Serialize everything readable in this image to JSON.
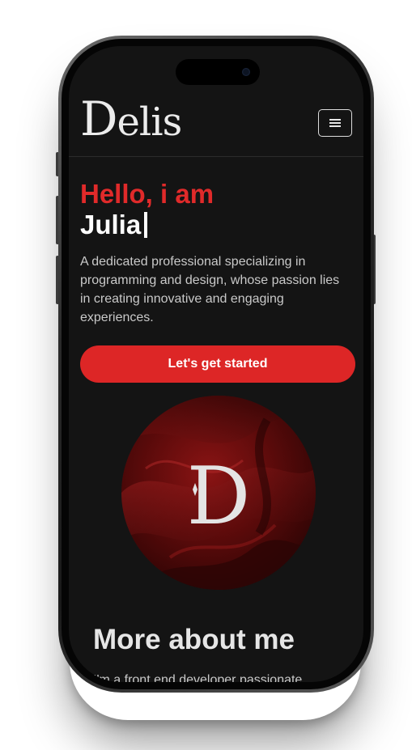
{
  "brand": {
    "logo_text": "Delis",
    "avatar_monogram": "D"
  },
  "header": {
    "menu_label": "Open menu"
  },
  "hero": {
    "greeting": "Hello, i am",
    "name": "Julia",
    "description": "A dedicated professional specializing in programming and design, whose passion lies in creating innovative and engaging experiences.",
    "cta_label": "Let's get started"
  },
  "about": {
    "title": "More about me",
    "intro": "I'm a front end developer passionate"
  },
  "colors": {
    "accent": "#dd2626",
    "background": "#141414",
    "text_primary": "#ffffff",
    "text_secondary": "#c9c9c9"
  },
  "icons": {
    "menu": "hamburger-icon",
    "cursor": "text-caret"
  }
}
